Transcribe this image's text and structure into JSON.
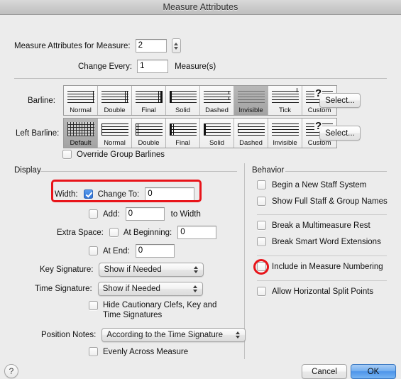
{
  "window": {
    "title": "Measure Attributes"
  },
  "top": {
    "measure_label": "Measure Attributes for Measure:",
    "measure_value": "2",
    "change_every_label": "Change Every:",
    "change_every_value": "1",
    "measures_suffix": "Measure(s)"
  },
  "barline": {
    "label": "Barline:",
    "select_label": "Select...",
    "selected": "Invisible",
    "options": [
      "Normal",
      "Double",
      "Final",
      "Solid",
      "Dashed",
      "Invisible",
      "Tick",
      "Custom"
    ]
  },
  "left_barline": {
    "label": "Left Barline:",
    "select_label": "Select...",
    "selected": "Default",
    "options": [
      "Default",
      "Normal",
      "Double",
      "Final",
      "Solid",
      "Dashed",
      "Invisible",
      "Custom"
    ]
  },
  "override_group_barlines": {
    "label": "Override Group Barlines",
    "checked": false
  },
  "display": {
    "group_title": "Display",
    "width_label": "Width:",
    "change_to_label": "Change To:",
    "change_to_checked": true,
    "change_to_value": "0",
    "add_label": "Add:",
    "add_checked": false,
    "add_value": "0",
    "to_width_label": "to Width",
    "extra_space_label": "Extra Space:",
    "at_beginning_label": "At Beginning:",
    "at_beginning_checked": false,
    "at_beginning_value": "0",
    "at_end_label": "At End:",
    "at_end_checked": false,
    "at_end_value": "0",
    "key_signature_label": "Key Signature:",
    "key_signature_value": "Show if Needed",
    "time_signature_label": "Time Signature:",
    "time_signature_value": "Show if Needed",
    "hide_cautionary_label_line1": "Hide Cautionary Clefs, Key and",
    "hide_cautionary_label_line2": "Time Signatures",
    "hide_cautionary_checked": false,
    "position_notes_label": "Position Notes:",
    "position_notes_value": "According to the Time Signature",
    "evenly_label": "Evenly Across Measure",
    "evenly_checked": false
  },
  "behavior": {
    "group_title": "Behavior",
    "items": [
      {
        "label": "Begin a New Staff System",
        "checked": false
      },
      {
        "label": "Show Full Staff & Group Names",
        "checked": false
      },
      {
        "label": "Break a Multimeasure Rest",
        "checked": false
      },
      {
        "label": "Break Smart Word Extensions",
        "checked": false
      },
      {
        "label": "Include in Measure Numbering",
        "checked": false
      },
      {
        "label": "Allow Horizontal Split Points",
        "checked": false
      }
    ]
  },
  "footer": {
    "help_label": "?",
    "cancel_label": "Cancel",
    "ok_label": "OK"
  },
  "colors": {
    "annotation_red": "#e8141a",
    "primary_button": "#4d95ea",
    "checkbox_checked": "#2f73d8"
  }
}
